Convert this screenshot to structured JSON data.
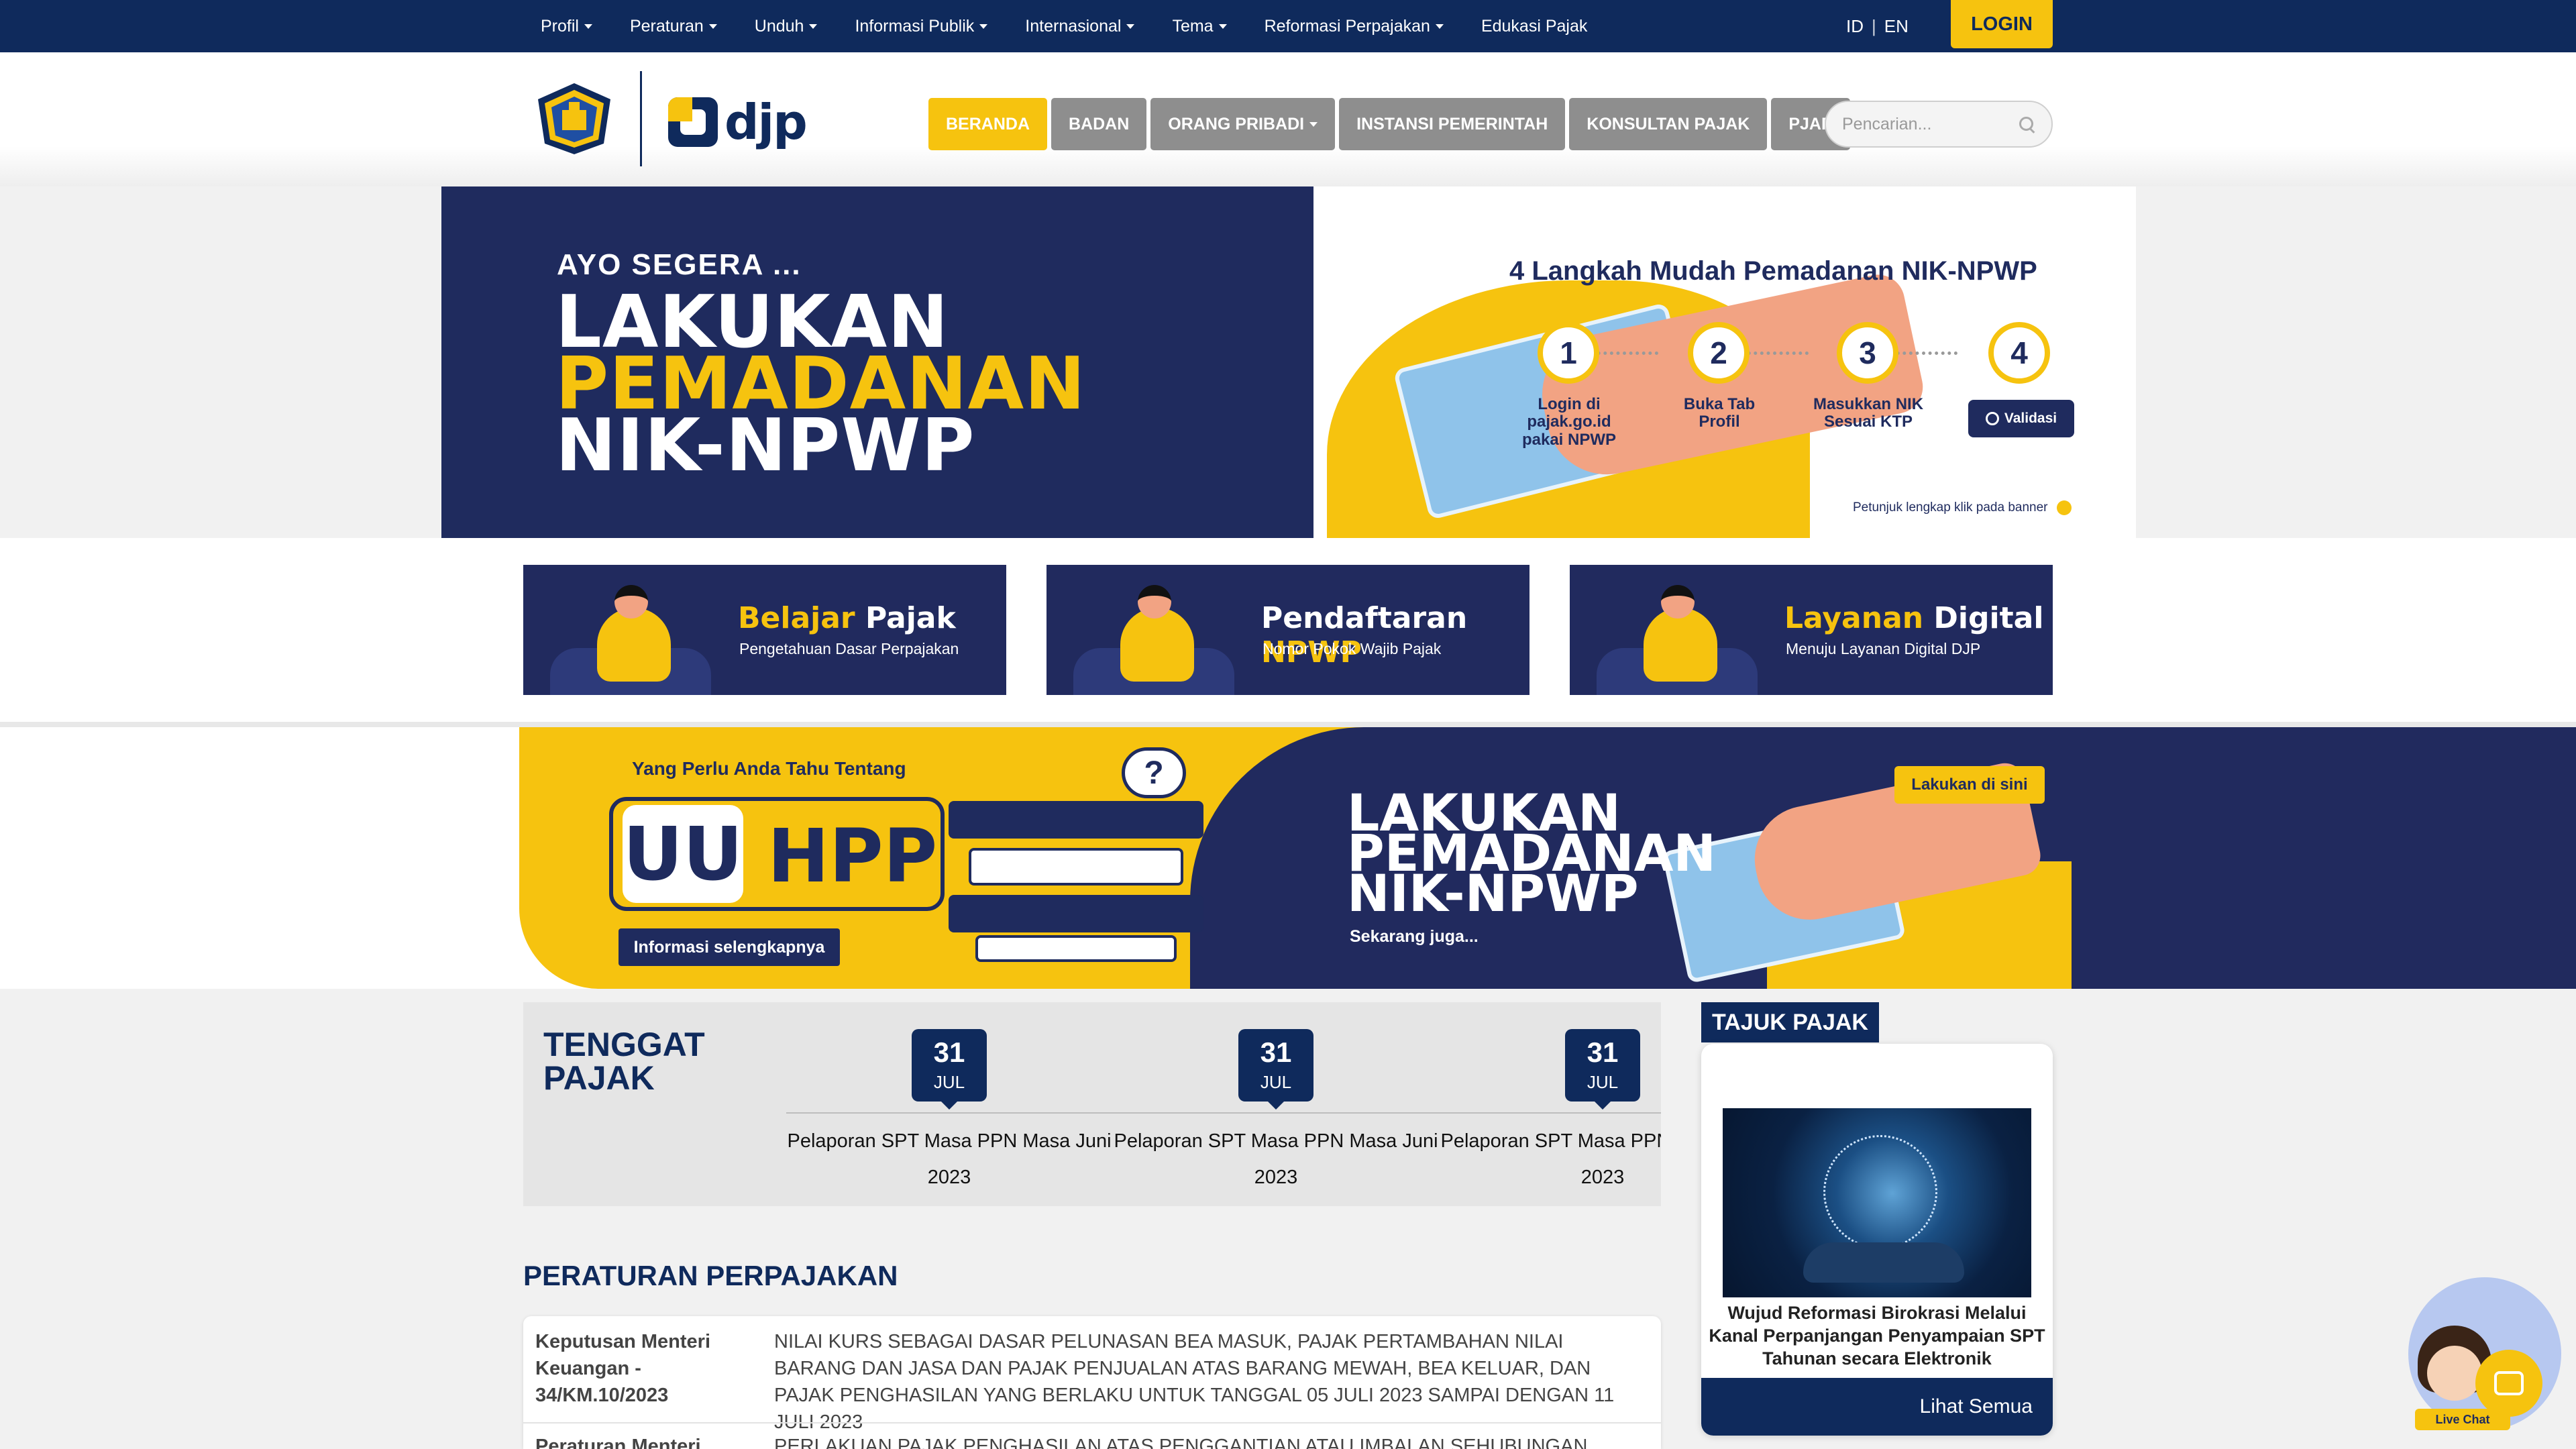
{
  "topnav": {
    "items": [
      {
        "label": "Profil",
        "dropdown": true
      },
      {
        "label": "Peraturan",
        "dropdown": true
      },
      {
        "label": "Unduh",
        "dropdown": true
      },
      {
        "label": "Informasi Publik",
        "dropdown": true
      },
      {
        "label": "Internasional",
        "dropdown": true
      },
      {
        "label": "Tema",
        "dropdown": true
      },
      {
        "label": "Reformasi Perpajakan",
        "dropdown": true
      },
      {
        "label": "Edukasi Pajak",
        "dropdown": false
      }
    ],
    "lang_id": "ID",
    "lang_sep": "|",
    "lang_en": "EN",
    "login": "LOGIN"
  },
  "header": {
    "logo_text": "djp",
    "nav": [
      {
        "label": "BERANDA",
        "active": true
      },
      {
        "label": "BADAN",
        "active": false
      },
      {
        "label": "ORANG PRIBADI",
        "active": false,
        "dropdown": true
      },
      {
        "label": "INSTANSI PEMERINTAH",
        "active": false
      },
      {
        "label": "KONSULTAN PAJAK",
        "active": false
      },
      {
        "label": "PJAP",
        "active": false
      }
    ],
    "search_placeholder": "Pencarian..."
  },
  "hero": {
    "kicker": "AYO SEGERA ...",
    "line1": "LAKUKAN",
    "line2": "PEMADANAN",
    "line3": "NIK-NPWP",
    "steps_title": "4 Langkah Mudah Pemadanan NIK-NPWP",
    "steps": [
      {
        "num": "1",
        "label": "Login di pajak.go.id pakai NPWP"
      },
      {
        "num": "2",
        "label": "Buka Tab Profil"
      },
      {
        "num": "3",
        "label": "Masukkan NIK Sesuai KTP"
      },
      {
        "num": "4",
        "label": ""
      }
    ],
    "validasi": "Validasi",
    "hint": "Petunjuk lengkap klik pada banner"
  },
  "services": [
    {
      "title_a": "Belajar",
      "title_b": " Pajak",
      "highlight": "a",
      "subtitle": "Pengetahuan Dasar Perpajakan"
    },
    {
      "title_a": "Pendaftaran",
      "title_b": " NPWP",
      "highlight": "b",
      "subtitle": "Nomor Pokok Wajib Pajak"
    },
    {
      "title_a": "Layanan",
      "title_b": " Digital",
      "highlight": "a",
      "subtitle": "Menuju Layanan Digital DJP"
    }
  ],
  "banner2": {
    "kicker": "Yang Perlu Anda Tahu Tentang",
    "uu": "UU",
    "hpp": "HPP",
    "info_button": "Informasi selengkapnya",
    "question": "?",
    "line1": "LAKUKAN",
    "line2": "PEMADANAN",
    "line3": "NIK-NPWP",
    "now": "Sekarang juga...",
    "cta": "Lakukan di sini"
  },
  "tenggat": {
    "title": "TENGGAT PAJAK",
    "events": [
      {
        "day": "31",
        "month": "JUL",
        "desc_line1": "Pelaporan SPT Masa PPN Masa Juni",
        "desc_line2": "2023"
      },
      {
        "day": "31",
        "month": "JUL",
        "desc_line1": "Pelaporan SPT Masa PPN Masa Juni",
        "desc_line2": "2023"
      },
      {
        "day": "31",
        "month": "JUL",
        "desc_line1": "Pelaporan SPT Masa PPN Masa Juni",
        "desc_line2": "2023"
      }
    ]
  },
  "tajuk": {
    "label": "TAJUK PAJAK",
    "article_title": "Wujud Reformasi Birokrasi Melalui Kanal Perpanjangan Penyampaian SPT Tahunan secara Elektronik",
    "see_all": "Lihat Semua"
  },
  "peraturan": {
    "title": "PERATURAN PERPAJAKAN",
    "rows": [
      {
        "code": "Keputusan Menteri Keuangan - 34/KM.10/2023",
        "desc": "NILAI KURS SEBAGAI DASAR PELUNASAN BEA MASUK, PAJAK PERTAMBAHAN NILAI BARANG DAN JASA DAN PAJAK PENJUALAN ATAS BARANG MEWAH, BEA KELUAR, DAN PAJAK PENGHASILAN YANG BERLAKU UNTUK TANGGAL 05 JULI 2023 SAMPAI DENGAN 11 JULI 2023"
      },
      {
        "code": "Peraturan Menteri",
        "desc": "PERLAKUAN PAJAK PENGHASILAN ATAS PENGGANTIAN ATAU IMBALAN SEHUBUNGAN DENGAN"
      }
    ]
  },
  "livechat": {
    "label": "Live Chat"
  },
  "colors": {
    "navy": "#0f2a5c",
    "banner_navy": "#1f2b5e",
    "yellow": "#f6c30f",
    "gray_button": "#8e8e8e"
  }
}
